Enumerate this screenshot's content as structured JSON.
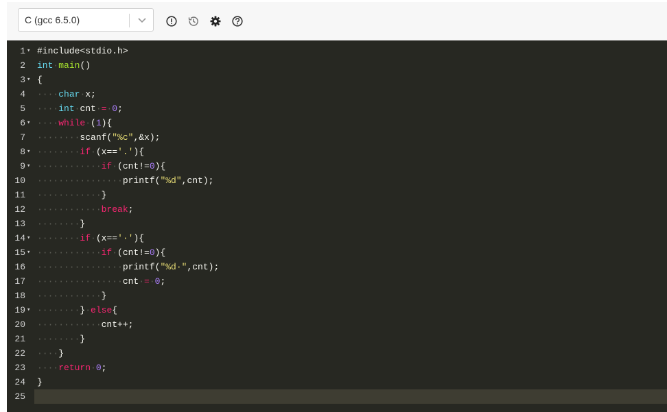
{
  "toolbar": {
    "language": "C (gcc 6.5.0)",
    "icons": [
      "alert-circle-icon",
      "history-icon",
      "gear-icon",
      "help-circle-icon"
    ]
  },
  "editor": {
    "theme_colors": {
      "background": "#272822",
      "keyword": "#f92672",
      "type": "#66d9ef",
      "number": "#ae81ff",
      "string": "#e6db74",
      "whitespace": "#5d5e56"
    },
    "lines": [
      {
        "n": "1",
        "fold": true,
        "tokens": [
          {
            "t": "#include<stdio.h>",
            "c": "pre"
          }
        ]
      },
      {
        "n": "2",
        "fold": false,
        "tokens": [
          {
            "t": "int",
            "c": "type"
          },
          {
            "t": "·",
            "c": "ws"
          },
          {
            "t": "main",
            "c": "fn"
          },
          {
            "t": "()",
            "c": "plain"
          }
        ]
      },
      {
        "n": "3",
        "fold": true,
        "tokens": [
          {
            "t": "{",
            "c": "plain"
          }
        ]
      },
      {
        "n": "4",
        "fold": false,
        "tokens": [
          {
            "t": "····",
            "c": "ws"
          },
          {
            "t": "char",
            "c": "type"
          },
          {
            "t": "·",
            "c": "ws"
          },
          {
            "t": "x;",
            "c": "plain"
          }
        ]
      },
      {
        "n": "5",
        "fold": false,
        "tokens": [
          {
            "t": "····",
            "c": "ws"
          },
          {
            "t": "int",
            "c": "type"
          },
          {
            "t": "·",
            "c": "ws"
          },
          {
            "t": "cnt",
            "c": "plain"
          },
          {
            "t": "·",
            "c": "ws"
          },
          {
            "t": "=",
            "c": "kw"
          },
          {
            "t": "·",
            "c": "ws"
          },
          {
            "t": "0",
            "c": "num"
          },
          {
            "t": ";",
            "c": "plain"
          }
        ]
      },
      {
        "n": "6",
        "fold": true,
        "tokens": [
          {
            "t": "····",
            "c": "ws"
          },
          {
            "t": "while",
            "c": "kw"
          },
          {
            "t": "·",
            "c": "ws"
          },
          {
            "t": "(",
            "c": "plain"
          },
          {
            "t": "1",
            "c": "num"
          },
          {
            "t": "){",
            "c": "plain"
          }
        ]
      },
      {
        "n": "7",
        "fold": false,
        "tokens": [
          {
            "t": "········",
            "c": "ws"
          },
          {
            "t": "scanf(",
            "c": "plain"
          },
          {
            "t": "\"%c\"",
            "c": "str"
          },
          {
            "t": ",&x);",
            "c": "plain"
          }
        ]
      },
      {
        "n": "8",
        "fold": true,
        "tokens": [
          {
            "t": "········",
            "c": "ws"
          },
          {
            "t": "if",
            "c": "kw"
          },
          {
            "t": "·",
            "c": "ws"
          },
          {
            "t": "(x==",
            "c": "plain"
          },
          {
            "t": "'.'",
            "c": "str"
          },
          {
            "t": "){",
            "c": "plain"
          }
        ]
      },
      {
        "n": "9",
        "fold": true,
        "tokens": [
          {
            "t": "············",
            "c": "ws"
          },
          {
            "t": "if",
            "c": "kw"
          },
          {
            "t": "·",
            "c": "ws"
          },
          {
            "t": "(cnt!=",
            "c": "plain"
          },
          {
            "t": "0",
            "c": "num"
          },
          {
            "t": "){",
            "c": "plain"
          }
        ]
      },
      {
        "n": "10",
        "fold": false,
        "tokens": [
          {
            "t": "················",
            "c": "ws"
          },
          {
            "t": "printf(",
            "c": "plain"
          },
          {
            "t": "\"%d\"",
            "c": "str"
          },
          {
            "t": ",cnt);",
            "c": "plain"
          }
        ]
      },
      {
        "n": "11",
        "fold": false,
        "tokens": [
          {
            "t": "············",
            "c": "ws"
          },
          {
            "t": "}",
            "c": "plain"
          }
        ]
      },
      {
        "n": "12",
        "fold": false,
        "tokens": [
          {
            "t": "············",
            "c": "ws"
          },
          {
            "t": "break",
            "c": "kw"
          },
          {
            "t": ";",
            "c": "plain"
          }
        ]
      },
      {
        "n": "13",
        "fold": false,
        "tokens": [
          {
            "t": "········",
            "c": "ws"
          },
          {
            "t": "}",
            "c": "plain"
          }
        ]
      },
      {
        "n": "14",
        "fold": true,
        "tokens": [
          {
            "t": "········",
            "c": "ws"
          },
          {
            "t": "if",
            "c": "kw"
          },
          {
            "t": "·",
            "c": "ws"
          },
          {
            "t": "(x==",
            "c": "plain"
          },
          {
            "t": "'·'",
            "c": "str"
          },
          {
            "t": "){",
            "c": "plain"
          }
        ]
      },
      {
        "n": "15",
        "fold": true,
        "tokens": [
          {
            "t": "············",
            "c": "ws"
          },
          {
            "t": "if",
            "c": "kw"
          },
          {
            "t": "·",
            "c": "ws"
          },
          {
            "t": "(cnt!=",
            "c": "plain"
          },
          {
            "t": "0",
            "c": "num"
          },
          {
            "t": "){",
            "c": "plain"
          }
        ]
      },
      {
        "n": "16",
        "fold": false,
        "tokens": [
          {
            "t": "················",
            "c": "ws"
          },
          {
            "t": "printf(",
            "c": "plain"
          },
          {
            "t": "\"%d·\"",
            "c": "str"
          },
          {
            "t": ",cnt);",
            "c": "plain"
          }
        ]
      },
      {
        "n": "17",
        "fold": false,
        "tokens": [
          {
            "t": "················",
            "c": "ws"
          },
          {
            "t": "cnt",
            "c": "plain"
          },
          {
            "t": "·",
            "c": "ws"
          },
          {
            "t": "=",
            "c": "kw"
          },
          {
            "t": "·",
            "c": "ws"
          },
          {
            "t": "0",
            "c": "num"
          },
          {
            "t": ";",
            "c": "plain"
          }
        ]
      },
      {
        "n": "18",
        "fold": false,
        "tokens": [
          {
            "t": "············",
            "c": "ws"
          },
          {
            "t": "}",
            "c": "plain"
          }
        ]
      },
      {
        "n": "19",
        "fold": true,
        "tokens": [
          {
            "t": "········",
            "c": "ws"
          },
          {
            "t": "}",
            "c": "plain"
          },
          {
            "t": "·",
            "c": "ws"
          },
          {
            "t": "else",
            "c": "kw"
          },
          {
            "t": "{",
            "c": "plain"
          }
        ]
      },
      {
        "n": "20",
        "fold": false,
        "tokens": [
          {
            "t": "············",
            "c": "ws"
          },
          {
            "t": "cnt++;",
            "c": "plain"
          }
        ]
      },
      {
        "n": "21",
        "fold": false,
        "tokens": [
          {
            "t": "········",
            "c": "ws"
          },
          {
            "t": "}",
            "c": "plain"
          }
        ]
      },
      {
        "n": "22",
        "fold": false,
        "tokens": [
          {
            "t": "····",
            "c": "ws"
          },
          {
            "t": "}",
            "c": "plain"
          }
        ]
      },
      {
        "n": "23",
        "fold": false,
        "tokens": [
          {
            "t": "····",
            "c": "ws"
          },
          {
            "t": "return",
            "c": "kw"
          },
          {
            "t": "·",
            "c": "ws"
          },
          {
            "t": "0",
            "c": "num"
          },
          {
            "t": ";",
            "c": "plain"
          }
        ]
      },
      {
        "n": "24",
        "fold": false,
        "tokens": [
          {
            "t": "}",
            "c": "plain"
          }
        ]
      },
      {
        "n": "25",
        "fold": false,
        "active": true,
        "tokens": []
      }
    ]
  }
}
